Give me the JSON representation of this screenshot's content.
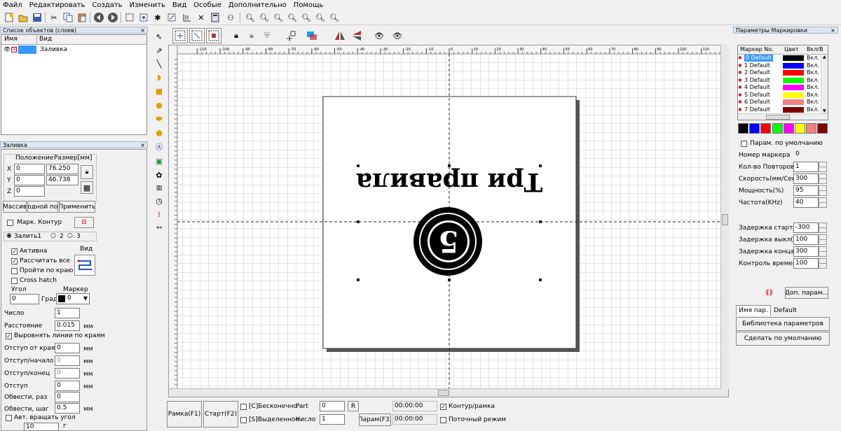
{
  "menu": [
    "Файл",
    "Редактировать",
    "Создать",
    "Изменить",
    "Вид",
    "Особые",
    "Дополнительно",
    "Помощь"
  ],
  "objects_panel": {
    "title": "Список объектов (слоев)",
    "col_name": "Имя",
    "col_view": "Вид",
    "row_name": "Заливка"
  },
  "fill_panel": {
    "title": "Заливка",
    "position_label": "Положение",
    "size_label": "Размер[мм]",
    "x_label": "X",
    "y_label": "Y",
    "z_label": "Z",
    "x": "0",
    "y": "0",
    "z": "0",
    "width": "76.250",
    "height": "46.738",
    "btn_array": "Массив",
    "btn_input": "ходной пор",
    "btn_apply": "Применить",
    "contour_label": "Марк. Контур",
    "fill1": "Залить1",
    "fill2": "2",
    "fill3": "3",
    "active": "Активна",
    "calc_all": "Рассчитать все",
    "edge": "Пройти по краю",
    "view_label": "Вид",
    "crosshatch": "Cross hatch",
    "angle_label": "Угол",
    "marker_label": "Маркер",
    "angle": "0",
    "deg": "Град",
    "marker_val": "0",
    "count_label": "Число",
    "count": "1",
    "distance_label": "Расстояние",
    "distance": "0.015",
    "unit_mm": "мм",
    "align_label": "Выровнять линии по краям",
    "edge_offset_label": "Отступ от края",
    "edge_offset": "0",
    "start_offset_label": "Отступ/начало",
    "start_offset": "0",
    "end_offset_label": "Отступ/конец",
    "end_offset": "0",
    "offset_label": "Отступ",
    "offset": "0",
    "loop_count_label": "Обвести, раз",
    "loop_count": "0",
    "loop_step_label": "Обвести, шаг",
    "loop_step": "0.5",
    "auto_rotate": "Авт. вращать угол",
    "auto_rotate_val": "10",
    "auto_rotate_unit": "г"
  },
  "ruler": {
    "top": [
      "-110",
      "-100",
      "-90",
      "-80",
      "-70",
      "-60",
      "-50",
      "-40",
      "-30",
      "-20",
      "-10",
      "0",
      "10",
      "20",
      "30",
      "40",
      "50",
      "60",
      "70",
      "80",
      "90",
      "100",
      "110"
    ]
  },
  "canvas": {
    "text": "Три правила",
    "digit": "5"
  },
  "bottom": {
    "frame_btn": "Рамка(F1)",
    "start_btn": "Старт(F2)",
    "infinite": "[C]Бесконечно",
    "selected": "[S]Выделенное",
    "part_label": "Part",
    "part": "0",
    "r_btn": "R",
    "count_label": "Число",
    "count": "1",
    "params_btn": "Парам(F3)",
    "time1": "00:00:00",
    "time2": "00:00:00",
    "contour": "Контур/рамка",
    "stream": "Поточный режим"
  },
  "right_panel": {
    "title": "Параметры Маркировки",
    "col_no": "Маркер No.",
    "col_color": "Цвет",
    "col_on": "Вкл/В",
    "rows": [
      {
        "name": "0 Default",
        "color": "#000000",
        "on": "Вкл."
      },
      {
        "name": "1 Default",
        "color": "#0000ff",
        "on": "Вкл."
      },
      {
        "name": "2 Default",
        "color": "#ff0000",
        "on": "Вкл."
      },
      {
        "name": "3 Default",
        "color": "#00ff00",
        "on": "Вкл."
      },
      {
        "name": "4 Default",
        "color": "#ff00ff",
        "on": "Вкл."
      },
      {
        "name": "5 Default",
        "color": "#ffff00",
        "on": "Вкл."
      },
      {
        "name": "6 Default",
        "color": "#f08080",
        "on": "Вкл."
      },
      {
        "name": "7 Default",
        "color": "#800000",
        "on": "Вкл."
      }
    ],
    "palette": [
      "#000000",
      "#0000ff",
      "#ff0000",
      "#00ff00",
      "#ff00ff",
      "#ffff00",
      "#f08080",
      "#800000"
    ],
    "default_params": "Парам. по умолчанию",
    "marker_no_label": "Номер маркера",
    "marker_no": "0",
    "repeat_label": "Кол-во Повторов",
    "repeat": "1",
    "speed_label": "Скорость(мм/Секу",
    "speed": "300",
    "power_label": "Мощность(%)",
    "power": "95",
    "freq_label": "Частота(KHz)",
    "freq": "40",
    "start_delay_label": "Задержка старта(м",
    "start_delay": "-300",
    "off_delay_label": "Задержка выкл(мк",
    "off_delay": "100",
    "end_delay_label": "Задержка конца(м",
    "end_delay": "300",
    "time_ctrl_label": "Контроль времени",
    "time_ctrl": "100",
    "more_btn": "Доп. парам...",
    "name_tab": "Имя пар.",
    "name_val": "Default",
    "library_btn": "Библиотека параметров",
    "make_default_btn": "Сделать по умолчанию"
  }
}
